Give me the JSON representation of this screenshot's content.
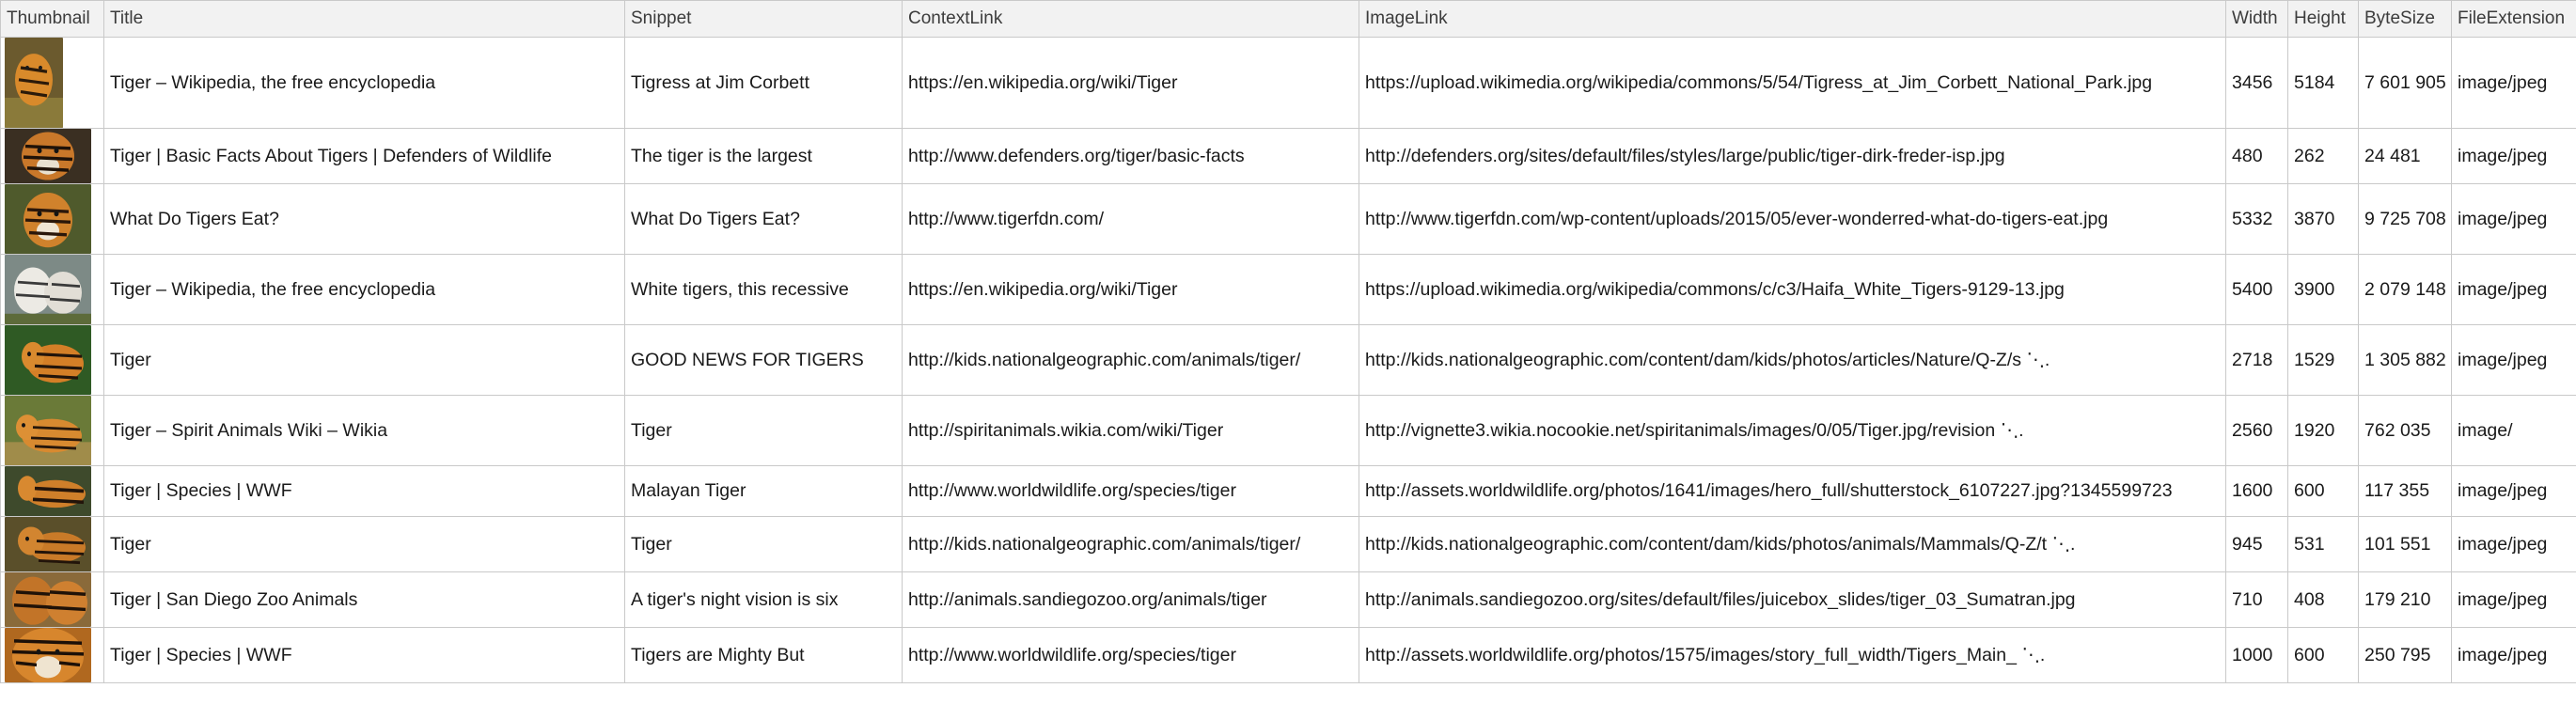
{
  "table": {
    "headers": [
      "Thumbnail",
      "Title",
      "Snippet",
      "ContextLink",
      "ImageLink",
      "Width",
      "Height",
      "ByteSize",
      "FileExtension"
    ],
    "rows": [
      {
        "thumbnail": "tiger-thumbnail",
        "title": "Tiger – Wikipedia, the free encyclopedia",
        "snippet": "Tigress at Jim Corbett",
        "context_link": "https://en.wikipedia.org/wiki/Tiger",
        "image_link": "https://upload.wikimedia.org/wikipedia/commons/5/54/Tigress_at_Jim_Corbett_National_Park.jpg",
        "width": "3456",
        "height": "5184",
        "byte_size": "7 601 905",
        "file_extension": "image/jpeg"
      },
      {
        "thumbnail": "tiger-thumbnail",
        "title": "Tiger | Basic Facts About Tigers | Defenders of Wildlife",
        "snippet": "The tiger is the largest",
        "context_link": "http://www.defenders.org/tiger/basic-facts",
        "image_link": "http://defenders.org/sites/default/files/styles/large/public/tiger-dirk-freder-isp.jpg",
        "width": "480",
        "height": "262",
        "byte_size": "24 481",
        "file_extension": "image/jpeg"
      },
      {
        "thumbnail": "tiger-thumbnail",
        "title": "What Do Tigers Eat?",
        "snippet": "What Do Tigers Eat?",
        "context_link": "http://www.tigerfdn.com/",
        "image_link": "http://www.tigerfdn.com/wp-content/uploads/2015/05/ever-wonderred-what-do-tigers-eat.jpg",
        "width": "5332",
        "height": "3870",
        "byte_size": "9 725 708",
        "file_extension": "image/jpeg"
      },
      {
        "thumbnail": "tiger-thumbnail",
        "title": "Tiger – Wikipedia, the free encyclopedia",
        "snippet": "White tigers, this recessive",
        "context_link": "https://en.wikipedia.org/wiki/Tiger",
        "image_link": "https://upload.wikimedia.org/wikipedia/commons/c/c3/Haifa_White_Tigers-9129-13.jpg",
        "width": "5400",
        "height": "3900",
        "byte_size": "2 079 148",
        "file_extension": "image/jpeg"
      },
      {
        "thumbnail": "tiger-thumbnail",
        "title": "Tiger",
        "snippet": "GOOD NEWS FOR TIGERS",
        "context_link": "http://kids.nationalgeographic.com/animals/tiger/",
        "image_link": "http://kids.nationalgeographic.com/content/dam/kids/photos/articles/Nature/Q-Z/s ⋱.",
        "width": "2718",
        "height": "1529",
        "byte_size": "1 305 882",
        "file_extension": "image/jpeg"
      },
      {
        "thumbnail": "tiger-thumbnail",
        "title": "Tiger – Spirit Animals Wiki – Wikia",
        "snippet": "Tiger",
        "context_link": "http://spiritanimals.wikia.com/wiki/Tiger",
        "image_link": "http://vignette3.wikia.nocookie.net/spiritanimals/images/0/05/Tiger.jpg/revision ⋱.",
        "width": "2560",
        "height": "1920",
        "byte_size": "762 035",
        "file_extension": "image/"
      },
      {
        "thumbnail": "tiger-thumbnail",
        "title": "Tiger | Species | WWF",
        "snippet": "Malayan Tiger",
        "context_link": "http://www.worldwildlife.org/species/tiger",
        "image_link": "http://assets.worldwildlife.org/photos/1641/images/hero_full/shutterstock_6107227.jpg?1345599723",
        "width": "1600",
        "height": "600",
        "byte_size": "117 355",
        "file_extension": "image/jpeg"
      },
      {
        "thumbnail": "tiger-thumbnail",
        "title": "Tiger",
        "snippet": "Tiger",
        "context_link": "http://kids.nationalgeographic.com/animals/tiger/",
        "image_link": "http://kids.nationalgeographic.com/content/dam/kids/photos/animals/Mammals/Q-Z/t ⋱.",
        "width": "945",
        "height": "531",
        "byte_size": "101 551",
        "file_extension": "image/jpeg"
      },
      {
        "thumbnail": "tiger-thumbnail",
        "title": "Tiger | San Diego Zoo Animals",
        "snippet": "A tiger's night vision is six",
        "context_link": "http://animals.sandiegozoo.org/animals/tiger",
        "image_link": "http://animals.sandiegozoo.org/sites/default/files/juicebox_slides/tiger_03_Sumatran.jpg",
        "width": "710",
        "height": "408",
        "byte_size": "179 210",
        "file_extension": "image/jpeg"
      },
      {
        "thumbnail": "tiger-thumbnail",
        "title": "Tiger | Species | WWF",
        "snippet": "Tigers are Mighty But",
        "context_link": "http://www.worldwildlife.org/species/tiger",
        "image_link": "http://assets.worldwildlife.org/photos/1575/images/story_full_width/Tigers_Main_ ⋱.",
        "width": "1000",
        "height": "600",
        "byte_size": "250 795",
        "file_extension": "image/jpeg"
      }
    ]
  }
}
